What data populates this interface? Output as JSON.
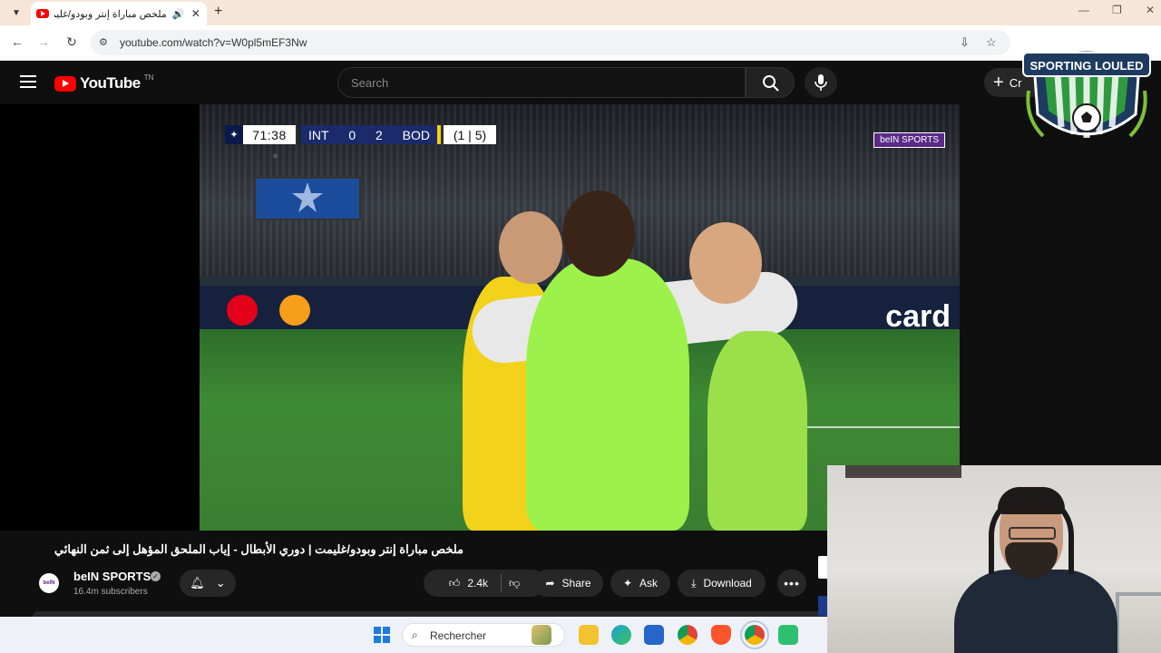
{
  "browser": {
    "tab": {
      "title": "ملخص مباراة إنتر وبودو/غليمت",
      "audio_icon": "speaker-icon",
      "close_glyph": "✕"
    },
    "new_tab_glyph": "+",
    "url": "youtube.com/watch?v=W0pl5mEF3Nw"
  },
  "youtube": {
    "logo_text": "YouTube",
    "logo_suffix": "TN",
    "search_placeholder": "Search",
    "create_label": "Cr"
  },
  "video": {
    "scoreboard": {
      "time": "71:38",
      "home": "INT",
      "home_score": "0",
      "away_score": "2",
      "away": "BOD",
      "aggregate": "(1 | 5)"
    },
    "broadcaster_badge": "beIN SPORTS",
    "ad_text": "card"
  },
  "overlay": {
    "channel_badge": "SPORTING LOULED"
  },
  "info": {
    "title": "ملخص مباراة إنتر وبودو/غليمت | دوري الأبطال - إياب الملحق المؤهل إلى ثمن النهائي",
    "channel_name": "beIN SPORTS",
    "subscribers": "16.4m subscribers",
    "likes": "2.4k",
    "share_label": "Share",
    "ask_label": "Ask",
    "download_label": "Download",
    "more_glyph": "•••"
  },
  "taskbar": {
    "search_text": "Rechercher"
  },
  "colors": {
    "yt_red": "#ff0000",
    "scoreboard_blue": "#1b2a6b",
    "bein_purple": "#5a2a86",
    "badge_green": "#2e9a3e"
  }
}
